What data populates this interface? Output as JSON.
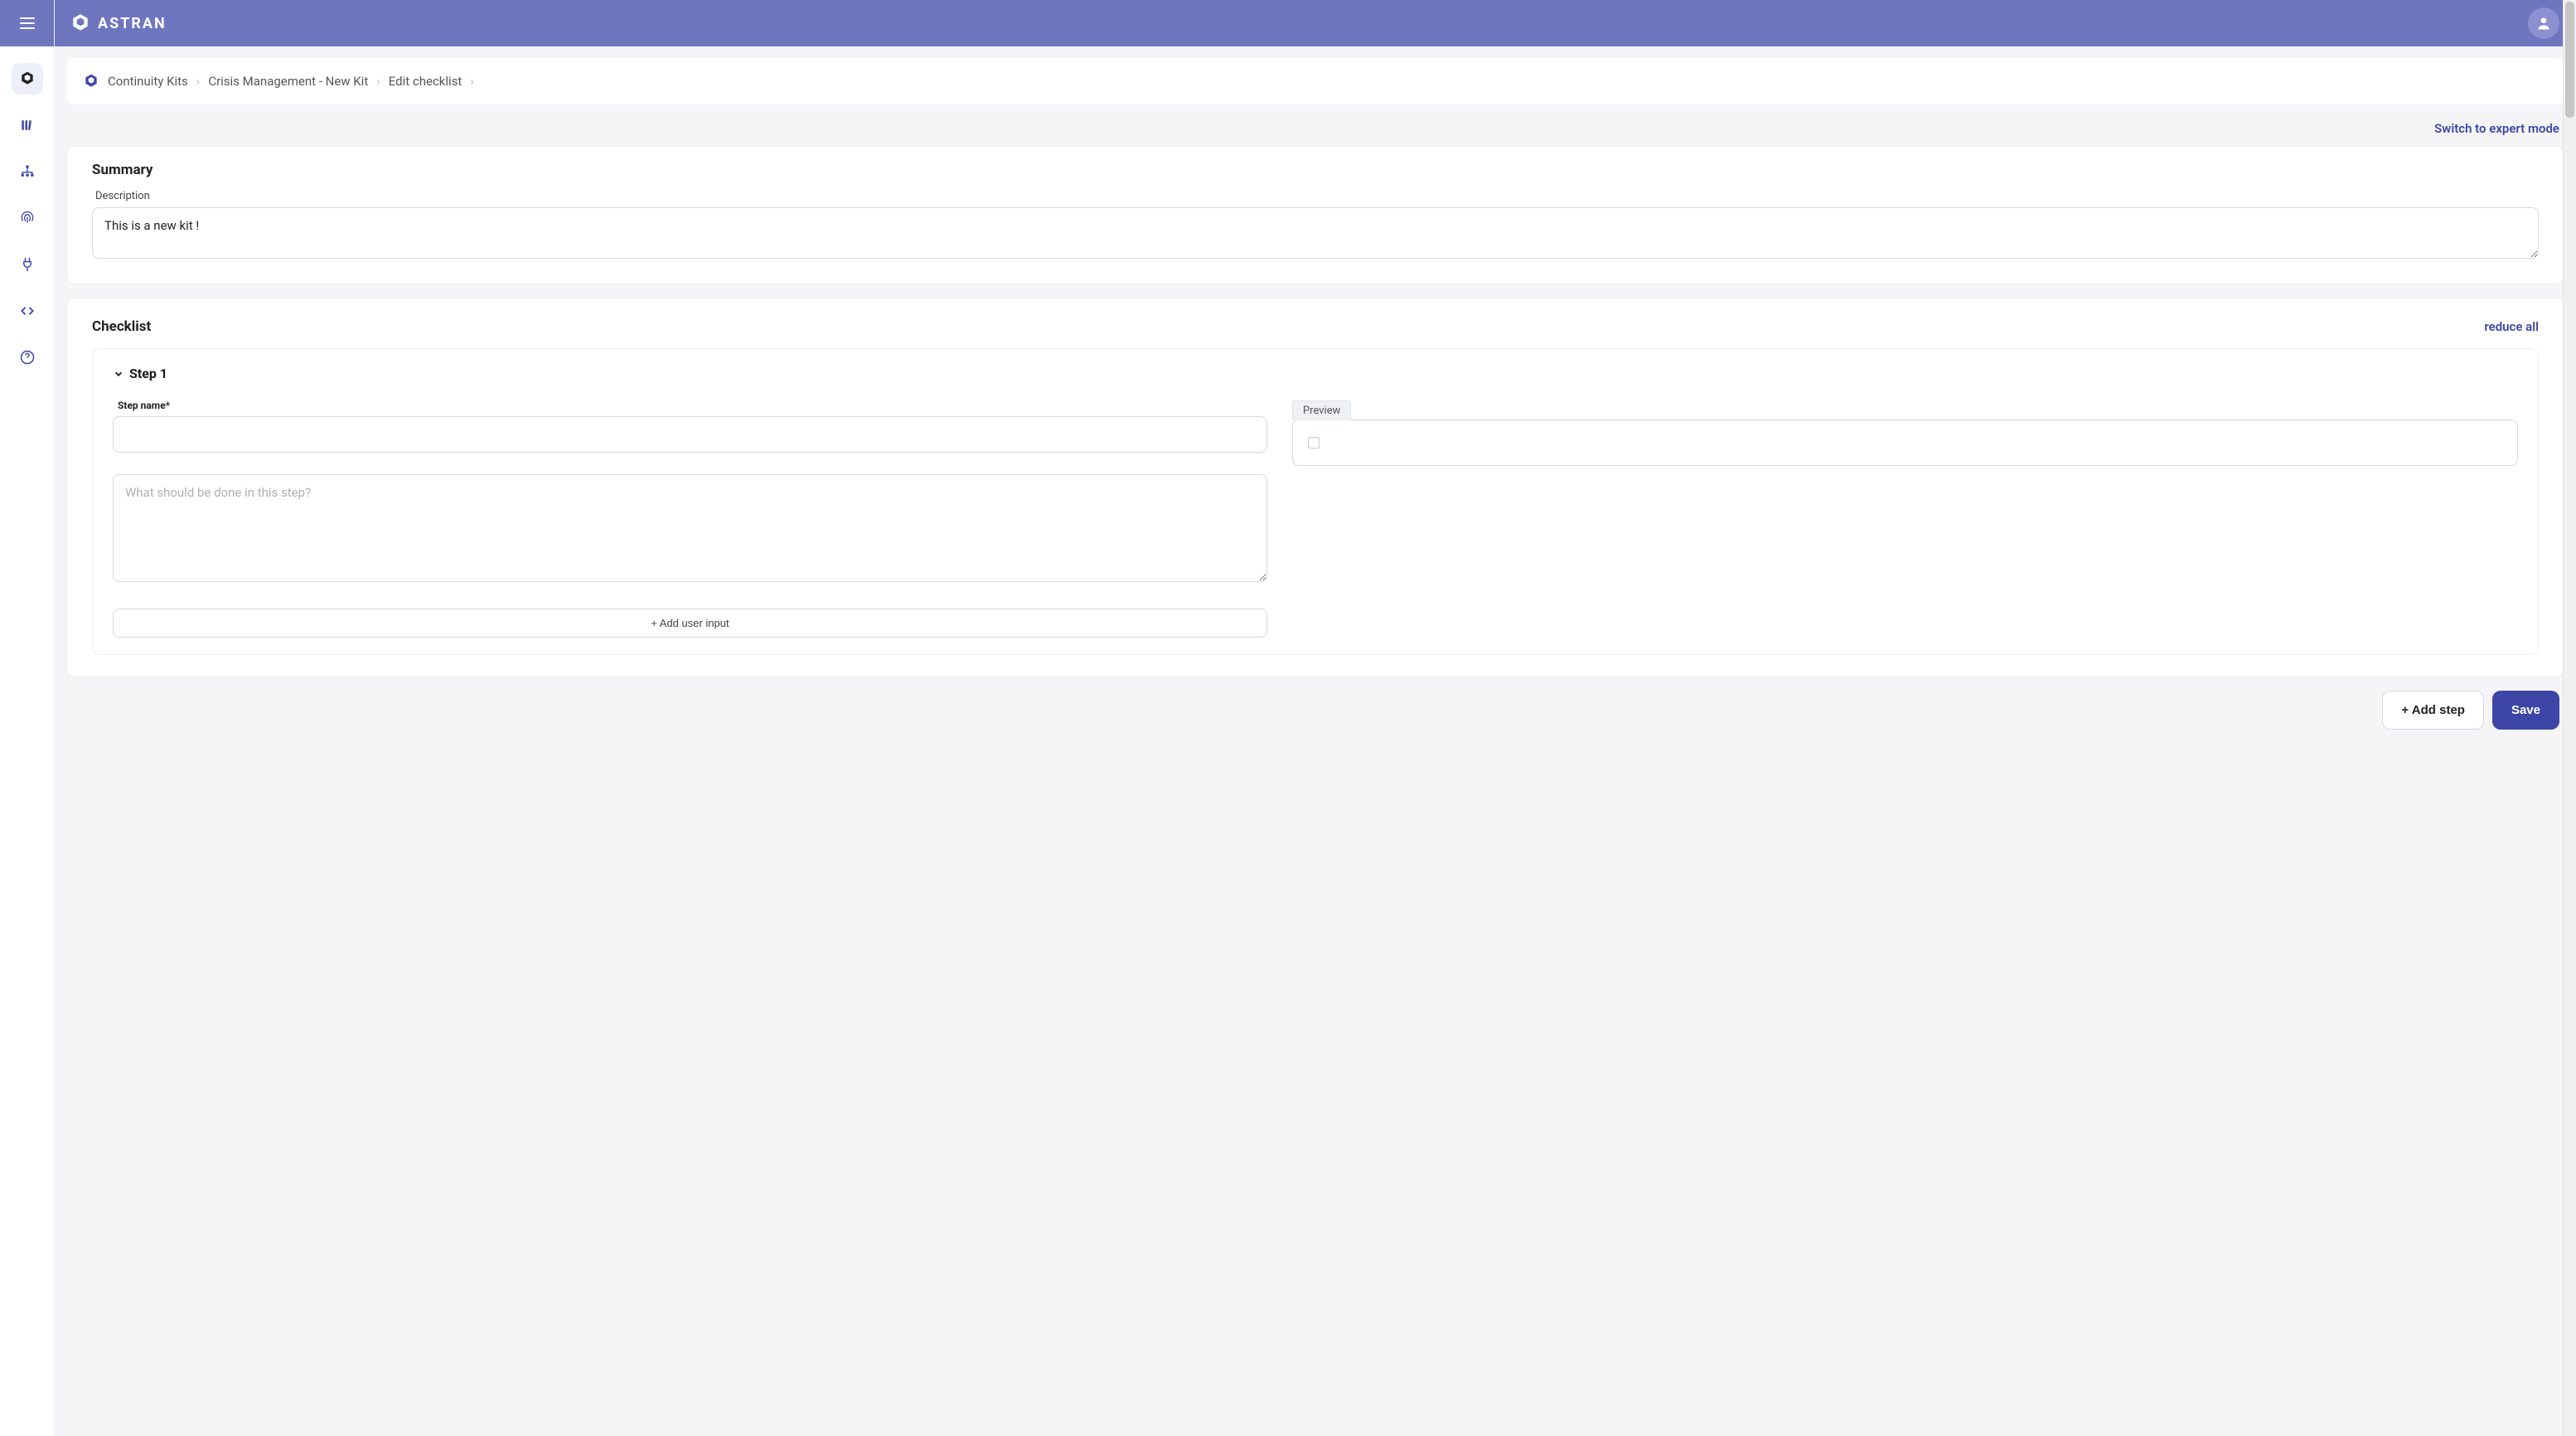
{
  "brand": {
    "name": "ASTRAN"
  },
  "breadcrumb": {
    "items": [
      "Continuity Kits",
      "Crisis Management - New Kit",
      "Edit checklist"
    ]
  },
  "expert_mode_link": "Switch to expert mode",
  "summary": {
    "title": "Summary",
    "description_label": "Description",
    "description_value": "This is a new kit !"
  },
  "checklist": {
    "title": "Checklist",
    "reduce_all": "reduce all",
    "steps": [
      {
        "header": "Step 1",
        "step_name_label": "Step name*",
        "step_name_value": "",
        "step_body_placeholder": "What should be done in this step?",
        "step_body_value": "",
        "add_user_input": "+ Add user input",
        "preview_label": "Preview"
      }
    ]
  },
  "footer": {
    "add_step": "+ Add step",
    "save": "Save"
  }
}
